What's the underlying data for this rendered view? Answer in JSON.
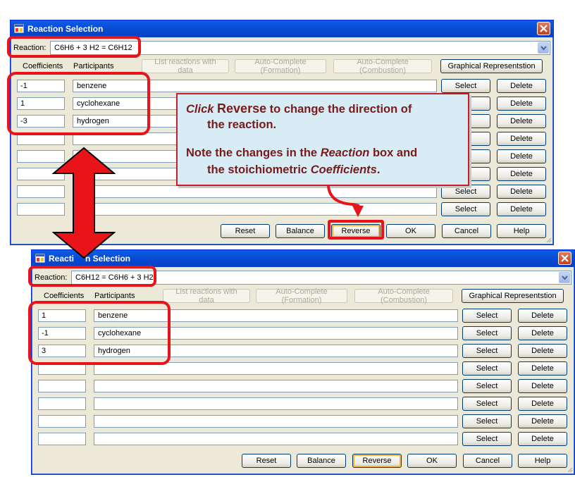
{
  "colors": {
    "accent_red": "#e8141a",
    "callout_bg": "#d8ecf6",
    "callout_text": "#7a1a1a",
    "titlebar": "#0a4bd6"
  },
  "icons": [
    "app-icon",
    "close-icon",
    "chevron-down-icon",
    "double-arrow-icon",
    "curved-arrow-icon"
  ],
  "top": {
    "title": "Reaction Selection",
    "reaction_label": "Reaction:",
    "reaction_value": "C6H6 + 3 H2 =  C6H12",
    "col_coefficients": "Coefficients",
    "col_participants": "Participants",
    "btn_list": "List reactions with data",
    "btn_auto_formation": "Auto-Complete (Formation)",
    "btn_auto_combustion": "Auto-Complete (Combustion)",
    "btn_graphical": "Graphical Representstion",
    "rows": [
      {
        "coef": "-1",
        "participant": "benzene"
      },
      {
        "coef": "1",
        "participant": "cyclohexane"
      },
      {
        "coef": "-3",
        "participant": "hydrogen"
      },
      {
        "coef": "",
        "participant": ""
      },
      {
        "coef": "",
        "participant": ""
      },
      {
        "coef": "",
        "participant": ""
      },
      {
        "coef": "",
        "participant": ""
      },
      {
        "coef": "",
        "participant": ""
      }
    ],
    "select_labels": [
      "Select",
      "ct",
      "ct",
      "ct",
      "ct",
      "ct",
      "Select",
      "Select"
    ],
    "delete_label": "Delete",
    "btn_reset": "Reset",
    "btn_balance": "Balance",
    "btn_reverse": "Reverse",
    "btn_ok": "OK",
    "btn_cancel": "Cancel",
    "btn_help": "Help"
  },
  "bottom": {
    "title": "Reaction Selection",
    "title_part1": "Reacti",
    "title_part2": "n Selection",
    "reaction_label": "Reaction:",
    "reaction_value": "C6H12 =  C6H6 + 3 H2",
    "col_coefficients": "Coefficients",
    "col_participants": "Participants",
    "btn_list": "List reactions with data",
    "btn_auto_formation": "Auto-Complete (Formation)",
    "btn_auto_combustion": "Auto-Complete (Combustion)",
    "btn_graphical": "Graphical Representstion",
    "rows": [
      {
        "coef": "1",
        "participant": "benzene"
      },
      {
        "coef": "-1",
        "participant": "cyclohexane"
      },
      {
        "coef": "3",
        "participant": "hydrogen"
      },
      {
        "coef": "",
        "participant": ""
      },
      {
        "coef": "",
        "participant": ""
      },
      {
        "coef": "",
        "participant": ""
      },
      {
        "coef": "",
        "participant": ""
      },
      {
        "coef": "",
        "participant": ""
      }
    ],
    "select_label": "Select",
    "delete_label": "Delete",
    "btn_reset": "Reset",
    "btn_balance": "Balance",
    "btn_reverse": "Reverse",
    "btn_ok": "OK",
    "btn_cancel": "Cancel",
    "btn_help": "Help"
  },
  "callout": {
    "click": "Click",
    "reverse": "Reverse",
    "line1_rest": " to change the direction of",
    "line2": "the reaction.",
    "line3_a": "Note the changes in the ",
    "line3_b": "Reaction",
    "line3_c": " box and",
    "line4_a": "the stoichiometric ",
    "line4_b": "Coefficients",
    "line4_c": "."
  }
}
